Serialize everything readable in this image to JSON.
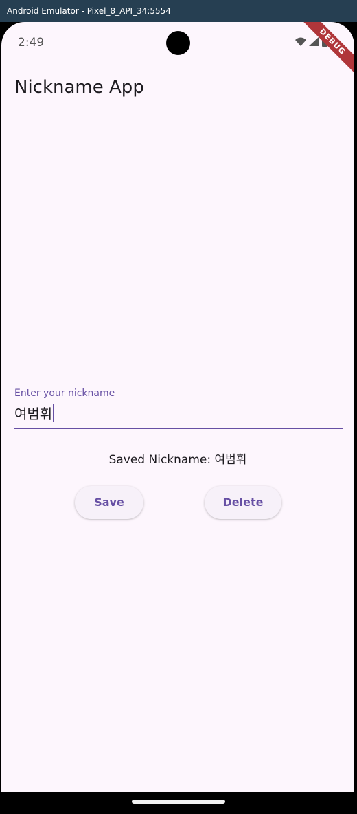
{
  "window": {
    "title": "Android Emulator - Pixel_8_API_34:5554"
  },
  "status_bar": {
    "time": "2:49",
    "icons": [
      "wifi-icon",
      "cellular-signal-icon",
      "battery-icon"
    ],
    "debug_banner": "DEBUG"
  },
  "app": {
    "title": "Nickname App"
  },
  "nickname_field": {
    "label": "Enter your nickname",
    "value": "여범휘"
  },
  "saved": {
    "text": "Saved Nickname: 여범휘"
  },
  "buttons": {
    "save_label": "Save",
    "delete_label": "Delete"
  },
  "colors": {
    "accent": "#6750a4",
    "background": "#fdf6fd",
    "titlebar": "#263f52",
    "debug_ribbon": "#b0363a"
  }
}
